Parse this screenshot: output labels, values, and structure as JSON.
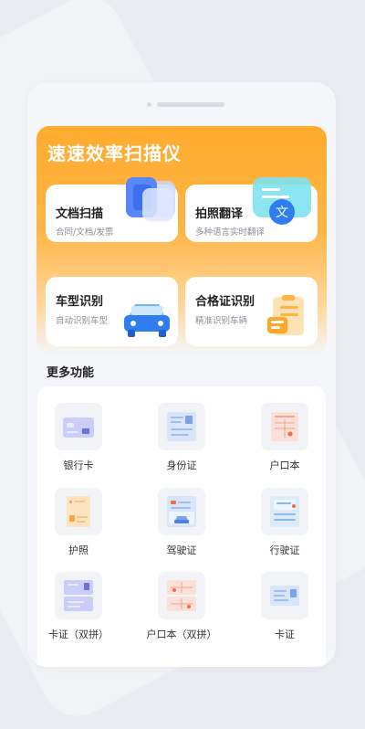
{
  "hero": {
    "title": "速速效率扫描仪",
    "cards": [
      {
        "title": "文档扫描",
        "subtitle": "合同/文档/发票",
        "icon": "document-stack-icon"
      },
      {
        "title": "拍照翻译",
        "subtitle": "多种语言实时翻译",
        "icon": "translate-icon"
      },
      {
        "title": "车型识别",
        "subtitle": "自动识别车型",
        "icon": "car-icon"
      },
      {
        "title": "合格证识别",
        "subtitle": "精准识别车辆",
        "icon": "certificate-icon"
      }
    ]
  },
  "more": {
    "title": "更多功能",
    "items": [
      {
        "label": "银行卡",
        "icon": "bank-card-icon"
      },
      {
        "label": "身份证",
        "icon": "id-card-icon"
      },
      {
        "label": "户口本",
        "icon": "household-register-icon"
      },
      {
        "label": "护照",
        "icon": "passport-icon"
      },
      {
        "label": "驾驶证",
        "icon": "driver-license-icon"
      },
      {
        "label": "行驶证",
        "icon": "vehicle-license-icon"
      },
      {
        "label": "卡证（双拼）",
        "icon": "card-double-icon"
      },
      {
        "label": "户口本（双拼）",
        "icon": "household-double-icon"
      },
      {
        "label": "卡证",
        "icon": "card-icon"
      }
    ]
  },
  "colors": {
    "accent": "#ffab2e",
    "blue": "#4a7cf5"
  }
}
